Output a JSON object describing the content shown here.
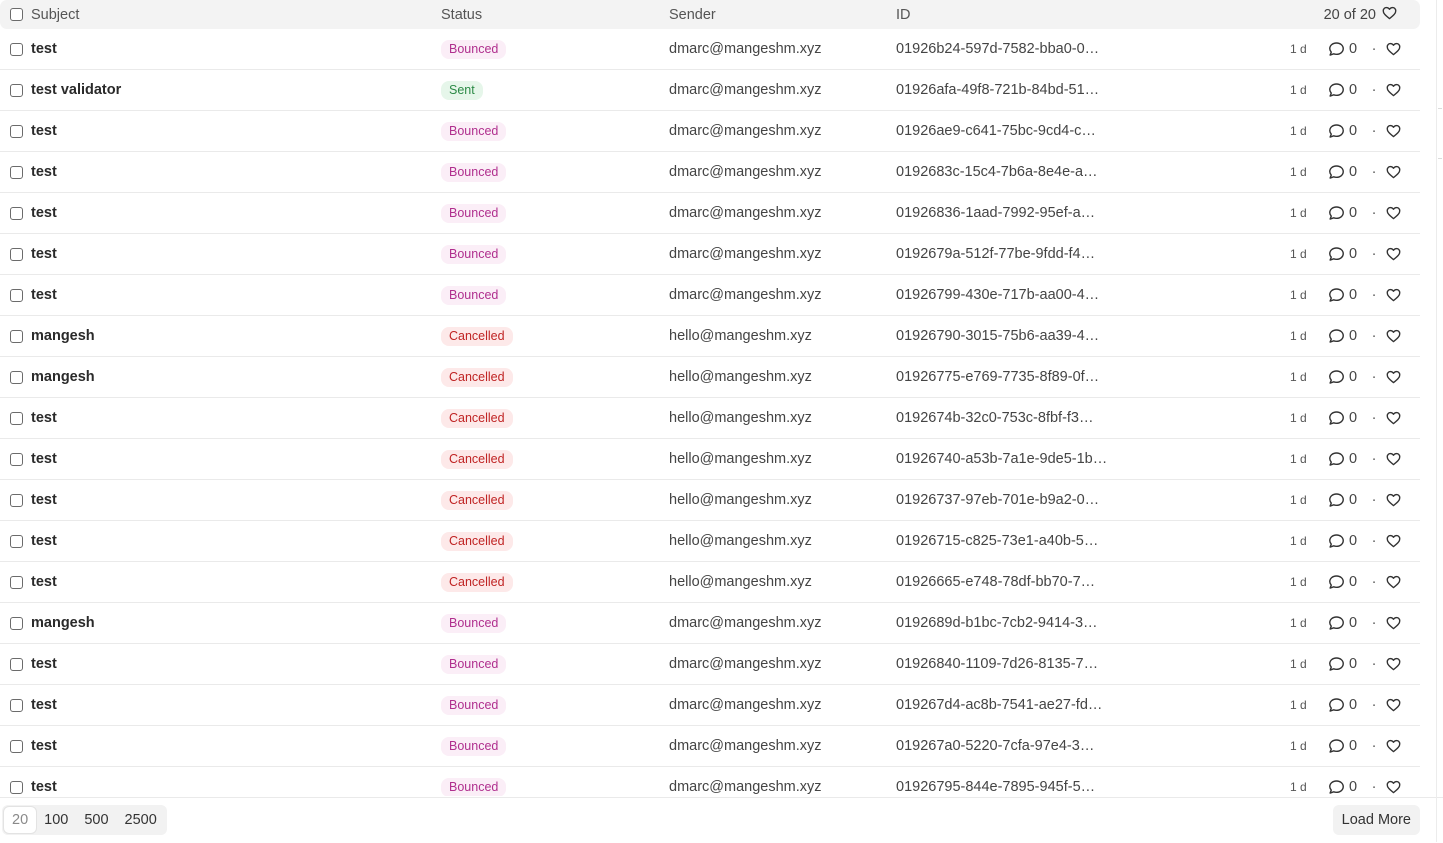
{
  "header": {
    "subject_label": "Subject",
    "status_label": "Status",
    "sender_label": "Sender",
    "id_label": "ID",
    "count_label": "20 of 20"
  },
  "rows": [
    {
      "subject": "test",
      "status": "Bounced",
      "status_kind": "bounced",
      "sender": "dmarc@mangeshm.xyz",
      "id": "01926b24-597d-7582-bba0-0…",
      "age": "1 d",
      "comments": "0"
    },
    {
      "subject": "test validator",
      "status": "Sent",
      "status_kind": "sent",
      "sender": "dmarc@mangeshm.xyz",
      "id": "01926afa-49f8-721b-84bd-51…",
      "age": "1 d",
      "comments": "0"
    },
    {
      "subject": "test",
      "status": "Bounced",
      "status_kind": "bounced",
      "sender": "dmarc@mangeshm.xyz",
      "id": "01926ae9-c641-75bc-9cd4-c…",
      "age": "1 d",
      "comments": "0"
    },
    {
      "subject": "test",
      "status": "Bounced",
      "status_kind": "bounced",
      "sender": "dmarc@mangeshm.xyz",
      "id": "0192683c-15c4-7b6a-8e4e-a…",
      "age": "1 d",
      "comments": "0"
    },
    {
      "subject": "test",
      "status": "Bounced",
      "status_kind": "bounced",
      "sender": "dmarc@mangeshm.xyz",
      "id": "01926836-1aad-7992-95ef-a…",
      "age": "1 d",
      "comments": "0"
    },
    {
      "subject": "test",
      "status": "Bounced",
      "status_kind": "bounced",
      "sender": "dmarc@mangeshm.xyz",
      "id": "0192679a-512f-77be-9fdd-f4…",
      "age": "1 d",
      "comments": "0"
    },
    {
      "subject": "test",
      "status": "Bounced",
      "status_kind": "bounced",
      "sender": "dmarc@mangeshm.xyz",
      "id": "01926799-430e-717b-aa00-4…",
      "age": "1 d",
      "comments": "0"
    },
    {
      "subject": "mangesh",
      "status": "Cancelled",
      "status_kind": "cancelled",
      "sender": "hello@mangeshm.xyz",
      "id": "01926790-3015-75b6-aa39-4…",
      "age": "1 d",
      "comments": "0"
    },
    {
      "subject": "mangesh",
      "status": "Cancelled",
      "status_kind": "cancelled",
      "sender": "hello@mangeshm.xyz",
      "id": "01926775-e769-7735-8f89-0f…",
      "age": "1 d",
      "comments": "0"
    },
    {
      "subject": "test",
      "status": "Cancelled",
      "status_kind": "cancelled",
      "sender": "hello@mangeshm.xyz",
      "id": "0192674b-32c0-753c-8fbf-f3…",
      "age": "1 d",
      "comments": "0"
    },
    {
      "subject": "test",
      "status": "Cancelled",
      "status_kind": "cancelled",
      "sender": "hello@mangeshm.xyz",
      "id": "01926740-a53b-7a1e-9de5-1b…",
      "age": "1 d",
      "comments": "0"
    },
    {
      "subject": "test",
      "status": "Cancelled",
      "status_kind": "cancelled",
      "sender": "hello@mangeshm.xyz",
      "id": "01926737-97eb-701e-b9a2-0…",
      "age": "1 d",
      "comments": "0"
    },
    {
      "subject": "test",
      "status": "Cancelled",
      "status_kind": "cancelled",
      "sender": "hello@mangeshm.xyz",
      "id": "01926715-c825-73e1-a40b-5…",
      "age": "1 d",
      "comments": "0"
    },
    {
      "subject": "test",
      "status": "Cancelled",
      "status_kind": "cancelled",
      "sender": "hello@mangeshm.xyz",
      "id": "01926665-e748-78df-bb70-7…",
      "age": "1 d",
      "comments": "0"
    },
    {
      "subject": "mangesh",
      "status": "Bounced",
      "status_kind": "bounced",
      "sender": "dmarc@mangeshm.xyz",
      "id": "0192689d-b1bc-7cb2-9414-3…",
      "age": "1 d",
      "comments": "0"
    },
    {
      "subject": "test",
      "status": "Bounced",
      "status_kind": "bounced",
      "sender": "dmarc@mangeshm.xyz",
      "id": "01926840-1109-7d26-8135-7…",
      "age": "1 d",
      "comments": "0"
    },
    {
      "subject": "test",
      "status": "Bounced",
      "status_kind": "bounced",
      "sender": "dmarc@mangeshm.xyz",
      "id": "019267d4-ac8b-7541-ae27-fd…",
      "age": "1 d",
      "comments": "0"
    },
    {
      "subject": "test",
      "status": "Bounced",
      "status_kind": "bounced",
      "sender": "dmarc@mangeshm.xyz",
      "id": "019267a0-5220-7cfa-97e4-3…",
      "age": "1 d",
      "comments": "0"
    },
    {
      "subject": "test",
      "status": "Bounced",
      "status_kind": "bounced",
      "sender": "dmarc@mangeshm.xyz",
      "id": "01926795-844e-7895-945f-5…",
      "age": "1 d",
      "comments": "0"
    }
  ],
  "row_separator": "·",
  "footer": {
    "page_sizes": [
      "20",
      "100",
      "500",
      "2500"
    ],
    "active_page_size": "20",
    "load_more_label": "Load More"
  },
  "colors": {
    "bounced": "#b02f8e",
    "sent": "#2c8a46",
    "cancelled": "#c02424"
  },
  "icons": {
    "comment": "comment-icon",
    "like": "heart-icon"
  }
}
